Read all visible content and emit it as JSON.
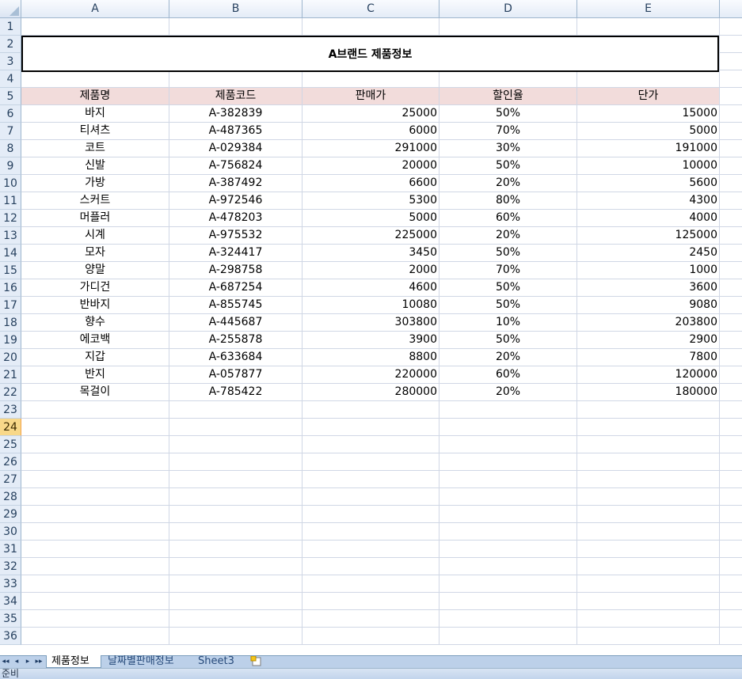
{
  "columns": [
    "A",
    "B",
    "C",
    "D",
    "E"
  ],
  "rows": [
    "1",
    "2",
    "3",
    "4",
    "5",
    "6",
    "7",
    "8",
    "9",
    "10",
    "11",
    "12",
    "13",
    "14",
    "15",
    "16",
    "17",
    "18",
    "19",
    "20",
    "21",
    "22",
    "23",
    "24",
    "25",
    "26",
    "27",
    "28",
    "29",
    "30",
    "31",
    "32",
    "33",
    "34",
    "35",
    "36"
  ],
  "active_row": "24",
  "title": "A브랜드 제품정보",
  "table": {
    "headers": [
      "제품명",
      "제품코드",
      "판매가",
      "할인율",
      "단가"
    ],
    "rows": [
      [
        "바지",
        "A-382839",
        "25000",
        "50%",
        "15000"
      ],
      [
        "티셔츠",
        "A-487365",
        "6000",
        "70%",
        "5000"
      ],
      [
        "코트",
        "A-029384",
        "291000",
        "30%",
        "191000"
      ],
      [
        "신발",
        "A-756824",
        "20000",
        "50%",
        "10000"
      ],
      [
        "가방",
        "A-387492",
        "6600",
        "20%",
        "5600"
      ],
      [
        "스커트",
        "A-972546",
        "5300",
        "80%",
        "4300"
      ],
      [
        "머플러",
        "A-478203",
        "5000",
        "60%",
        "4000"
      ],
      [
        "시계",
        "A-975532",
        "225000",
        "20%",
        "125000"
      ],
      [
        "모자",
        "A-324417",
        "3450",
        "50%",
        "2450"
      ],
      [
        "양말",
        "A-298758",
        "2000",
        "70%",
        "1000"
      ],
      [
        "가디건",
        "A-687254",
        "4600",
        "50%",
        "3600"
      ],
      [
        "반바지",
        "A-855745",
        "10080",
        "50%",
        "9080"
      ],
      [
        "향수",
        "A-445687",
        "303800",
        "10%",
        "203800"
      ],
      [
        "에코백",
        "A-255878",
        "3900",
        "50%",
        "2900"
      ],
      [
        "지갑",
        "A-633684",
        "8800",
        "20%",
        "7800"
      ],
      [
        "반지",
        "A-057877",
        "220000",
        "60%",
        "120000"
      ],
      [
        "목걸이",
        "A-785422",
        "280000",
        "20%",
        "180000"
      ]
    ]
  },
  "tabs": {
    "nav": [
      "◂◂",
      "◂",
      "▸",
      "▸▸"
    ],
    "sheet1": "제품정보",
    "sheet2": "날짜별판매정보",
    "sheet3": "Sheet3"
  },
  "status": "준비",
  "colors": {
    "header_fill": "#f2dcdb",
    "active_row": "#f8d88a",
    "tab_bar": "#bcd0e9"
  }
}
